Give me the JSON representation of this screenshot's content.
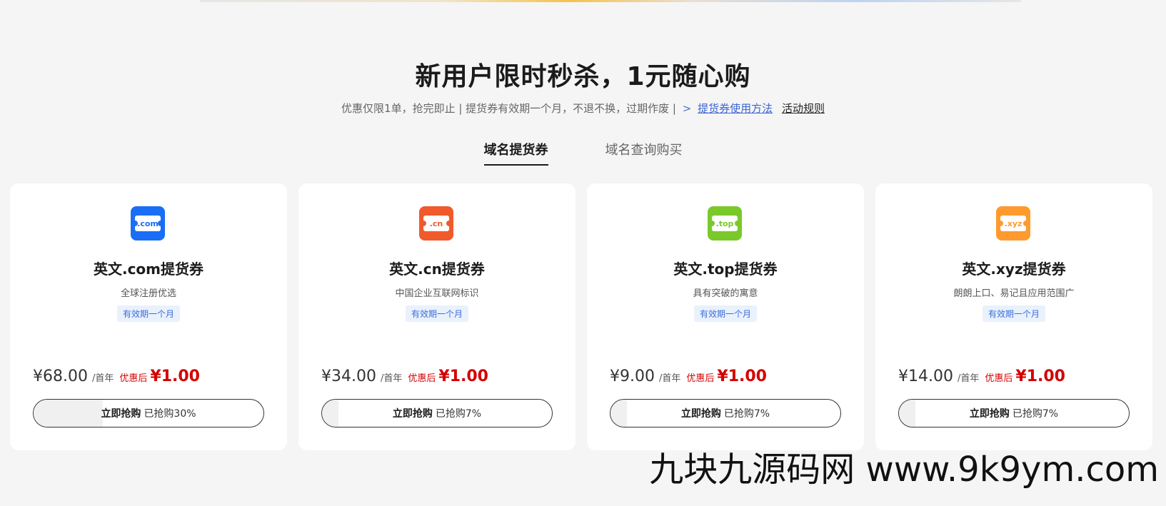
{
  "header": {
    "title": "新用户限时秒杀，1元随心购",
    "subtitle_text": "优惠仅限1单，抢完即止 | 提货券有效期一个月，不退不换，过期作废 |",
    "subtitle_arrow": ">",
    "link_usage": "提货券使用方法",
    "link_rules": "活动规则"
  },
  "tabs": [
    {
      "label": "域名提货券",
      "active": true
    },
    {
      "label": "域名查询购买",
      "active": false
    }
  ],
  "cards": [
    {
      "icon_label": ".com",
      "icon_color": "#1a6ef5",
      "title": "英文.com提货券",
      "desc": "全球注册优选",
      "badge": "有效期一个月",
      "orig_price": "¥68.00",
      "unit": "/首年",
      "after_label": "优惠后",
      "final_price": "¥1.00",
      "btn_label": "立即抢购",
      "sold": "已抢购30%",
      "progress": 0.3
    },
    {
      "icon_label": ".cn",
      "icon_color": "#f15a2b",
      "title": "英文.cn提货券",
      "desc": "中国企业互联网标识",
      "badge": "有效期一个月",
      "orig_price": "¥34.00",
      "unit": "/首年",
      "after_label": "优惠后",
      "final_price": "¥1.00",
      "btn_label": "立即抢购",
      "sold": "已抢购7%",
      "progress": 0.07
    },
    {
      "icon_label": ".top",
      "icon_color": "#7ac92a",
      "title": "英文.top提货券",
      "desc": "具有突破的寓意",
      "badge": "有效期一个月",
      "orig_price": "¥9.00",
      "unit": "/首年",
      "after_label": "优惠后",
      "final_price": "¥1.00",
      "btn_label": "立即抢购",
      "sold": "已抢购7%",
      "progress": 0.07
    },
    {
      "icon_label": ".xyz",
      "icon_color": "#ff9a2e",
      "title": "英文.xyz提货券",
      "desc": "朗朗上口、易记且应用范围广",
      "badge": "有效期一个月",
      "orig_price": "¥14.00",
      "unit": "/首年",
      "after_label": "优惠后",
      "final_price": "¥1.00",
      "btn_label": "立即抢购",
      "sold": "已抢购7%",
      "progress": 0.07
    }
  ],
  "watermark": "九块九源码网 www.9k9ym.com"
}
